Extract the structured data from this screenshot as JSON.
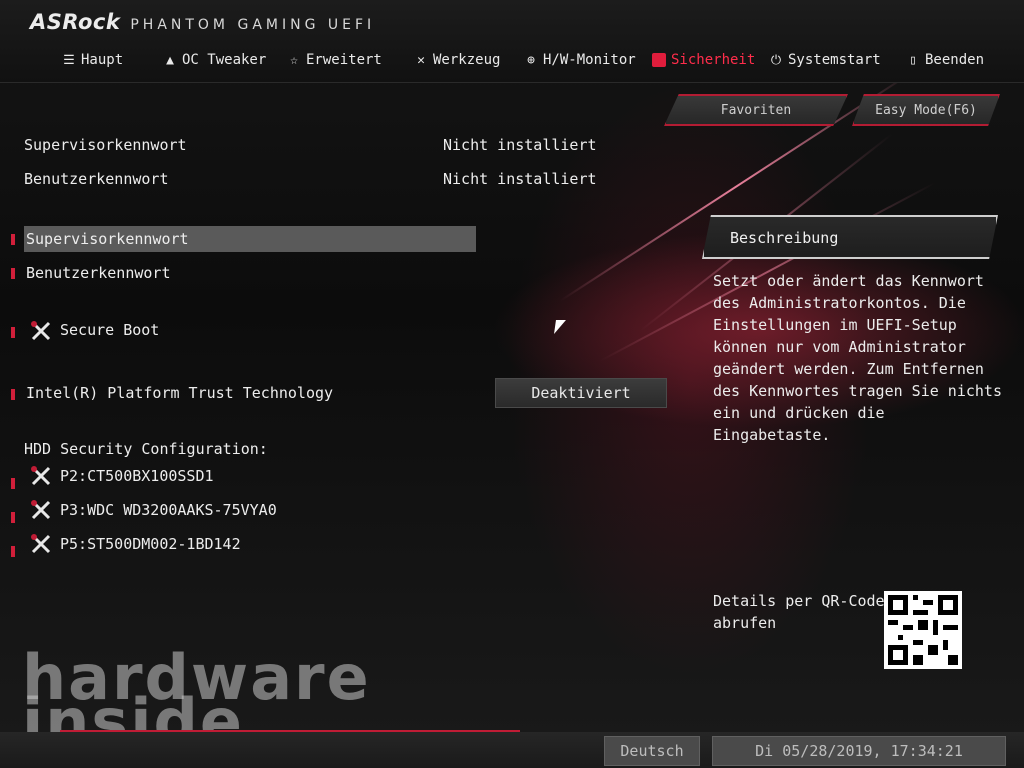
{
  "header": {
    "brand": "ASRock",
    "subtitle": "PHANTOM GAMING UEFI"
  },
  "nav": [
    {
      "label": "Haupt",
      "icon": "list-icon"
    },
    {
      "label": "OC Tweaker",
      "icon": "rocket-icon"
    },
    {
      "label": "Erweitert",
      "icon": "star-icon"
    },
    {
      "label": "Werkzeug",
      "icon": "tools-icon"
    },
    {
      "label": "H/W-Monitor",
      "icon": "crosshair-icon"
    },
    {
      "label": "Sicherheit",
      "icon": "shield-icon",
      "active": true
    },
    {
      "label": "Systemstart",
      "icon": "power-icon"
    },
    {
      "label": "Beenden",
      "icon": "exit-icon"
    }
  ],
  "top_buttons": {
    "favorites": "Favoriten",
    "easy_mode": "Easy Mode(F6)"
  },
  "status": [
    {
      "label": "Supervisorkennwort",
      "value": "Nicht installiert"
    },
    {
      "label": "Benutzerkennwort",
      "value": "Nicht installiert"
    }
  ],
  "options": {
    "supervisor_password": "Supervisorkennwort",
    "user_password": "Benutzerkennwort",
    "secure_boot": "Secure Boot",
    "ptt_label": "Intel(R) Platform Trust Technology",
    "ptt_value": "Deaktiviert"
  },
  "hdd": {
    "heading": "HDD Security Configuration:",
    "drives": [
      "P2:CT500BX100SSD1",
      "P3:WDC WD3200AAKS-75VYA0",
      "P5:ST500DM002-1BD142"
    ]
  },
  "description": {
    "title": "Beschreibung",
    "text": "Setzt oder ändert das Kennwort\ndes Administratorkontos. Die\nEinstellungen im UEFI-Setup\nkönnen nur vom Administrator\ngeändert werden. Zum Entfernen\ndes Kennwortes tragen Sie nichts\nein und drücken die Eingabetaste."
  },
  "qr": {
    "label": "Details per QR-Code\nabrufen"
  },
  "watermark": {
    "line1": "hardware",
    "line2": "inside"
  },
  "footer": {
    "language": "Deutsch",
    "datetime": "Di 05/28/2019, 17:34:21"
  },
  "colors": {
    "accent": "#e01d3c",
    "active_nav": "#ff2d4b",
    "selected_row": "#5a5a5a"
  }
}
